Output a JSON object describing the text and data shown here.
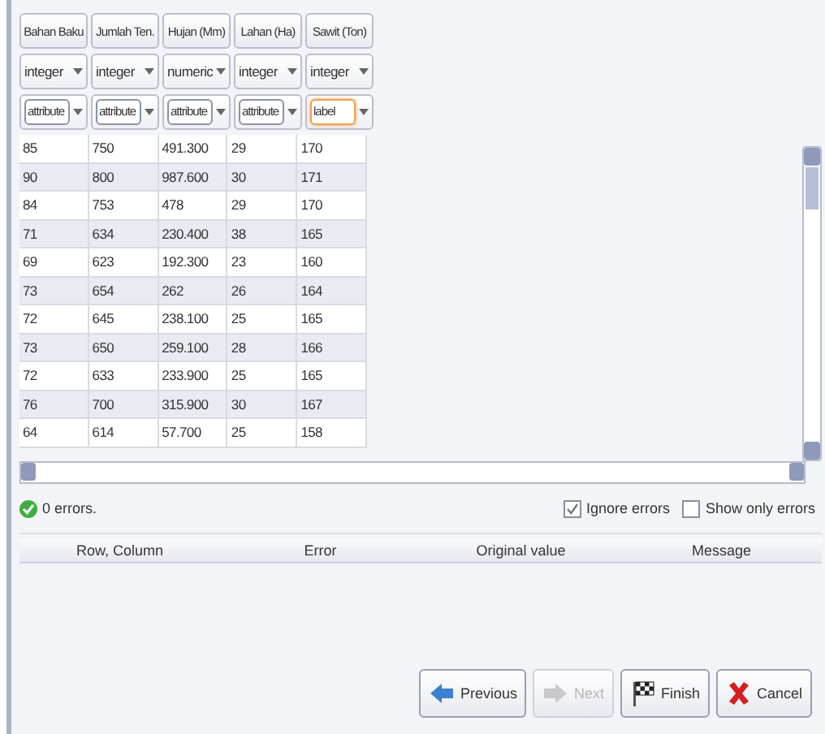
{
  "columns": [
    {
      "name": "Bahan Baku",
      "type": "integer",
      "role": "attribute",
      "focused": false
    },
    {
      "name": "Jumlah Ten.",
      "type": "integer",
      "role": "attribute",
      "focused": false
    },
    {
      "name": "Hujan (Mm)",
      "type": "numeric",
      "role": "attribute",
      "focused": false
    },
    {
      "name": "Lahan (Ha)",
      "type": "integer",
      "role": "attribute",
      "focused": false
    },
    {
      "name": "Sawit (Ton)",
      "type": "integer",
      "role": "label",
      "focused": true
    }
  ],
  "rows": [
    [
      "85",
      "750",
      "491.300",
      "29",
      "170"
    ],
    [
      "90",
      "800",
      "987.600",
      "30",
      "171"
    ],
    [
      "84",
      "753",
      "478",
      "29",
      "170"
    ],
    [
      "71",
      "634",
      "230.400",
      "38",
      "165"
    ],
    [
      "69",
      "623",
      "192.300",
      "23",
      "160"
    ],
    [
      "73",
      "654",
      "262",
      "26",
      "164"
    ],
    [
      "72",
      "645",
      "238.100",
      "25",
      "165"
    ],
    [
      "73",
      "650",
      "259.100",
      "28",
      "166"
    ],
    [
      "72",
      "633",
      "233.900",
      "25",
      "165"
    ],
    [
      "76",
      "700",
      "315.900",
      "30",
      "167"
    ],
    [
      "64",
      "614",
      "57.700",
      "25",
      "158"
    ]
  ],
  "status": {
    "text": "0 errors.",
    "ok": true
  },
  "options": [
    {
      "label": "Ignore errors",
      "checked": true
    },
    {
      "label": "Show only errors",
      "checked": false
    }
  ],
  "error_table": {
    "columns": [
      "Row, Column",
      "Error",
      "Original value",
      "Message"
    ]
  },
  "buttons": [
    {
      "label": "Previous",
      "kind": "previous",
      "disabled": false
    },
    {
      "label": "Next",
      "kind": "next",
      "disabled": true
    },
    {
      "label": "Finish",
      "kind": "finish",
      "disabled": false
    },
    {
      "label": "Cancel",
      "kind": "cancel",
      "disabled": false
    }
  ]
}
